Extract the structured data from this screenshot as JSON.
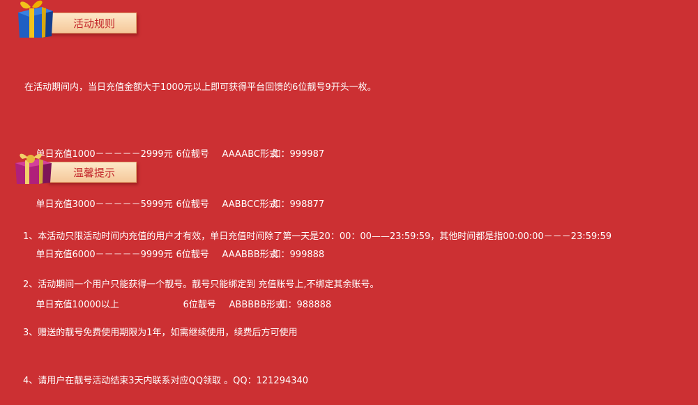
{
  "rules": {
    "title": "活动规则",
    "intro": "在活动期间内，当日充值金额大于1000元以上即可获得平台回馈的6位靓号9开头一枚。",
    "tiers": [
      {
        "range": "单日充值1000－－－－－2999元",
        "digits": "6位靓号",
        "pattern": "AAAABC形式",
        "example": "如：999987"
      },
      {
        "range": "单日充值3000－－－－－5999元",
        "digits": "6位靓号",
        "pattern": "AABBCC形式",
        "example": "如：998877"
      },
      {
        "range": "单日充值6000－－－－－9999元",
        "digits": "6位靓号",
        "pattern": "AAABBB形式",
        "example": "如：999888"
      },
      {
        "range": "单日充值10000以上",
        "digits": "6位靓号",
        "pattern": "ABBBBB形式",
        "example": "如：988888"
      }
    ]
  },
  "tips": {
    "title": "温馨提示",
    "items": [
      "1、本活动只限活动时间内充值的用户才有效，单日充值时间除了第一天是20：00：00——23:59:59，其他时间都是指00:00:00－－－23:59:59",
      "2、活动期间一个用户只能获得一个靓号。靓号只能绑定到 充值账号上,不绑定其余账号。",
      "3、赠送的靓号免费使用期限为1年，如需继续使用，续费后方可使用",
      "4、请用户在靓号活动结束3天内联系对应QQ领取 。QQ：121294340"
    ]
  },
  "colors": {
    "background": "#cc3033",
    "tag_bg": "#f9d9b2",
    "tag_text": "#c3272b",
    "text": "#ffffff"
  }
}
